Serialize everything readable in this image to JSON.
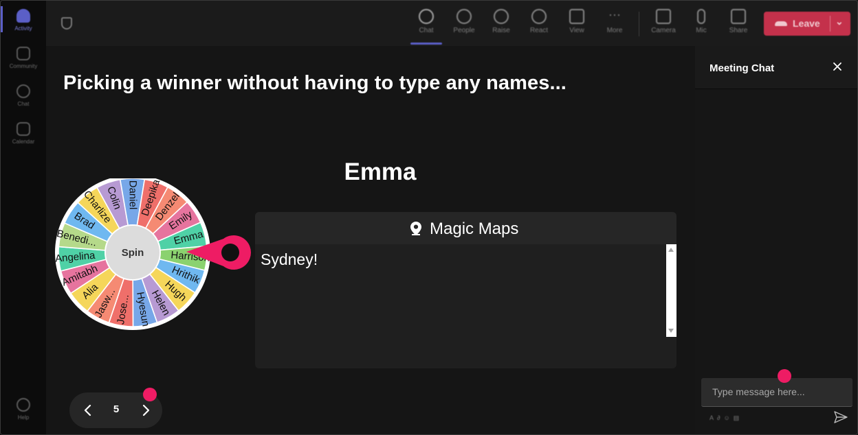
{
  "rail": {
    "items": [
      {
        "label": "Activity",
        "icon": "bell-icon"
      },
      {
        "label": "Community",
        "icon": "community-icon"
      },
      {
        "label": "Chat",
        "icon": "chat-icon"
      },
      {
        "label": "Calendar",
        "icon": "calendar-icon"
      }
    ],
    "help_label": "Help"
  },
  "toolbar": {
    "buttons": [
      {
        "label": "Chat",
        "icon": "chat-icon"
      },
      {
        "label": "People",
        "icon": "people-icon"
      },
      {
        "label": "Raise",
        "icon": "raise-hand-icon"
      },
      {
        "label": "React",
        "icon": "smile-icon"
      },
      {
        "label": "View",
        "icon": "grid-icon"
      },
      {
        "label": "More",
        "icon": "more-icon"
      },
      {
        "label": "Camera",
        "icon": "camera-off-icon"
      },
      {
        "label": "Mic",
        "icon": "mic-icon"
      },
      {
        "label": "Share",
        "icon": "share-icon"
      }
    ],
    "leave_label": "Leave"
  },
  "stage": {
    "title": "Picking a winner without having to type any names...",
    "winner": "Emma",
    "spin_label": "Spin",
    "wheel_names": [
      "Emily",
      "Emma",
      "Harrison",
      "Hrithik",
      "Hugh",
      "Helen",
      "Hyesun",
      "Jose...",
      "Jasw...",
      "Alia",
      "Amitabh",
      "Angelina",
      "Benedi...",
      "Brad",
      "Charlize",
      "Colin",
      "Daniel",
      "Deepika",
      "Denzel"
    ],
    "wheel_colors": [
      "#e6749e",
      "#4fd1a6",
      "#8bd26f",
      "#6fb8f0",
      "#f5d65a",
      "#b79ad3",
      "#77a7e8",
      "#ef6f6a",
      "#f58a73",
      "#f5d65a",
      "#e6749e",
      "#4fd1a6",
      "#b5d98a",
      "#6fb8f0",
      "#f5d65a",
      "#b79ad3",
      "#77a7e8",
      "#ef6f6a",
      "#f58a73"
    ],
    "pointer_color": "#ee1c64"
  },
  "panel": {
    "title": "Magic Maps",
    "text": "Sydney!"
  },
  "pager": {
    "page": "5"
  },
  "chat": {
    "title": "Meeting Chat",
    "input_placeholder": "Type message here..."
  },
  "colors": {
    "accent": "#5b5fc7",
    "leave": "#c4314b",
    "highlight_dot": "#ee1c64"
  }
}
